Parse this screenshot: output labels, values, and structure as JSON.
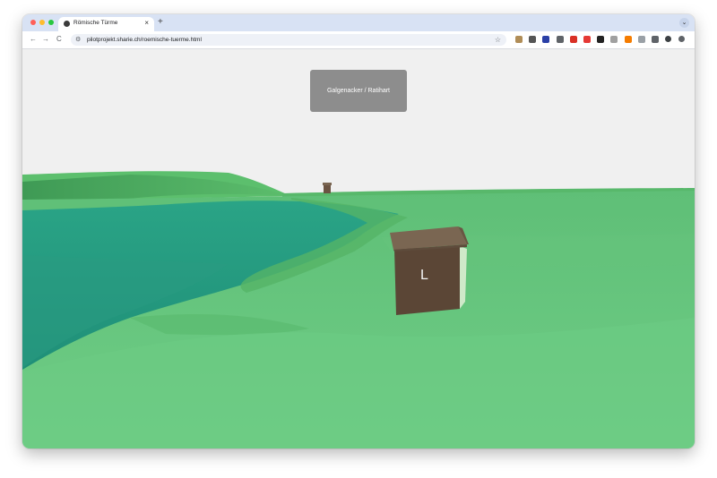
{
  "browser": {
    "tab": {
      "title": "Römische Türme",
      "close_label": "×"
    },
    "new_tab_label": "+",
    "tab_search_label": "⌄",
    "nav": {
      "back": "←",
      "forward": "→",
      "reload": "C"
    },
    "address_bar": {
      "site_info_icon": "tune-icon",
      "url": "pilotprojekt.sharie.ch/roemische-tuerme.html",
      "bookmark_icon": "☆"
    },
    "extensions": [
      {
        "name": "extension-1-icon",
        "color": "#b08d57"
      },
      {
        "name": "extension-2-icon",
        "color": "#555555"
      },
      {
        "name": "extension-3-icon",
        "color": "#2a3fa6"
      },
      {
        "name": "extension-4-icon",
        "color": "#5f6368"
      },
      {
        "name": "extension-5-icon",
        "color": "#d93025"
      },
      {
        "name": "extension-6-icon",
        "color": "#e53935"
      },
      {
        "name": "extension-7-icon",
        "color": "#222222"
      },
      {
        "name": "extension-8-icon",
        "color": "#a0a0a0"
      },
      {
        "name": "extension-9-icon",
        "color": "#f57c00"
      },
      {
        "name": "extension-10-icon",
        "color": "#9aa0a6"
      },
      {
        "name": "extension-11-icon",
        "color": "#5f6368"
      },
      {
        "name": "profile-icon",
        "color": "#3c4043"
      },
      {
        "name": "menu-icon",
        "color": "#5f6368"
      }
    ]
  },
  "scene": {
    "location_label": "Galgenacker / Ratihart",
    "tower_label": "L",
    "colors": {
      "sky": "#f0f0f0",
      "water": "#2a9e86",
      "terrain_light": "#6fcd86",
      "terrain_dark": "#3f9a55",
      "tower_wall": "#5a4637",
      "tower_roof": "#7a6652",
      "panel": "#8d8d8d"
    }
  }
}
